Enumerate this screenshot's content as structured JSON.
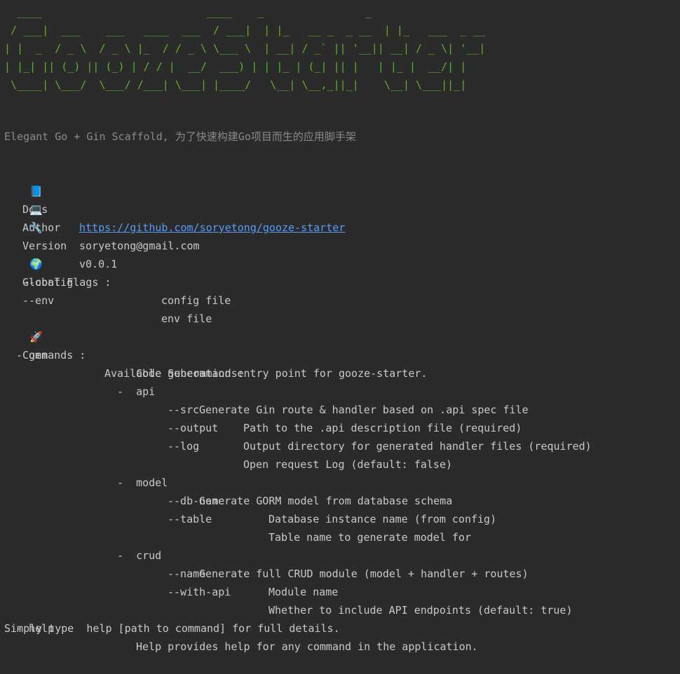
{
  "banner": {
    "ascii": "  ____                          ____    _                _\n / ___|  ___    ___   ____  ___  / ___|  | |_   __ _  _ __  | |_   ___  _ __\n| |  _  / _ \\  / _ \\ |_  / / _ \\ \\___ \\  | __| / _` || '__|| __| / _ \\| '__|\n| |_| || (_) || (_) | / / |  __/  ___) | | |_ | (_| || |   | |_ |  __/| |\n \\____| \\___/  \\___/ /___| \\___| |____/   \\__| \\__,_||_|    \\__| \\___||_|"
  },
  "tagline": "Elegant Go + Gin Scaffold, 为了快速构建Go项目而生的应用脚手架",
  "info": {
    "docs": {
      "icon": "📘",
      "label": "Docs",
      "value": "https://github.com/soryetong/gooze-starter"
    },
    "author": {
      "icon": "💻",
      "label": "Author",
      "value": "soryetong@gmail.com"
    },
    "version": {
      "icon": "🔧",
      "label": "Version",
      "value": "v0.0.1"
    }
  },
  "global_flags": {
    "icon": "🌍",
    "title": "Global Flags :",
    "flags": [
      {
        "name": "--config",
        "desc": "config file"
      },
      {
        "name": "--env",
        "desc": "env file"
      }
    ]
  },
  "commands": {
    "icon": "🚀",
    "title": "Commands :",
    "gen": {
      "name": "- gen",
      "desc": "Code generation entry point for gooze-starter.",
      "subtitle": "Available Subcommands:",
      "api": {
        "name": "-  api",
        "desc": "Generate Gin route & handler based on .api spec file",
        "flags": [
          {
            "name": "--src",
            "desc": "Path to the .api description file (required)"
          },
          {
            "name": "--output",
            "desc": "Output directory for generated handler files (required)"
          },
          {
            "name": "--log",
            "desc": "Open request Log (default: false)"
          }
        ]
      },
      "model": {
        "name": "-  model",
        "desc": "Generate GORM model from database schema",
        "flags": [
          {
            "name": "--db-name",
            "desc": "Database instance name (from config)"
          },
          {
            "name": "--table",
            "desc": "Table name to generate model for"
          }
        ]
      },
      "crud": {
        "name": "-  crud",
        "desc": "Generate full CRUD module (model + handler + routes)",
        "flags": [
          {
            "name": "--name",
            "desc": "Module name"
          },
          {
            "name": "--with-api",
            "desc": "Whether to include API endpoints (default: true)"
          }
        ]
      }
    },
    "help": {
      "name": "- help",
      "desc": "Help provides help for any command in the application."
    }
  },
  "footer": "Simply type  help [path to command] for full details."
}
